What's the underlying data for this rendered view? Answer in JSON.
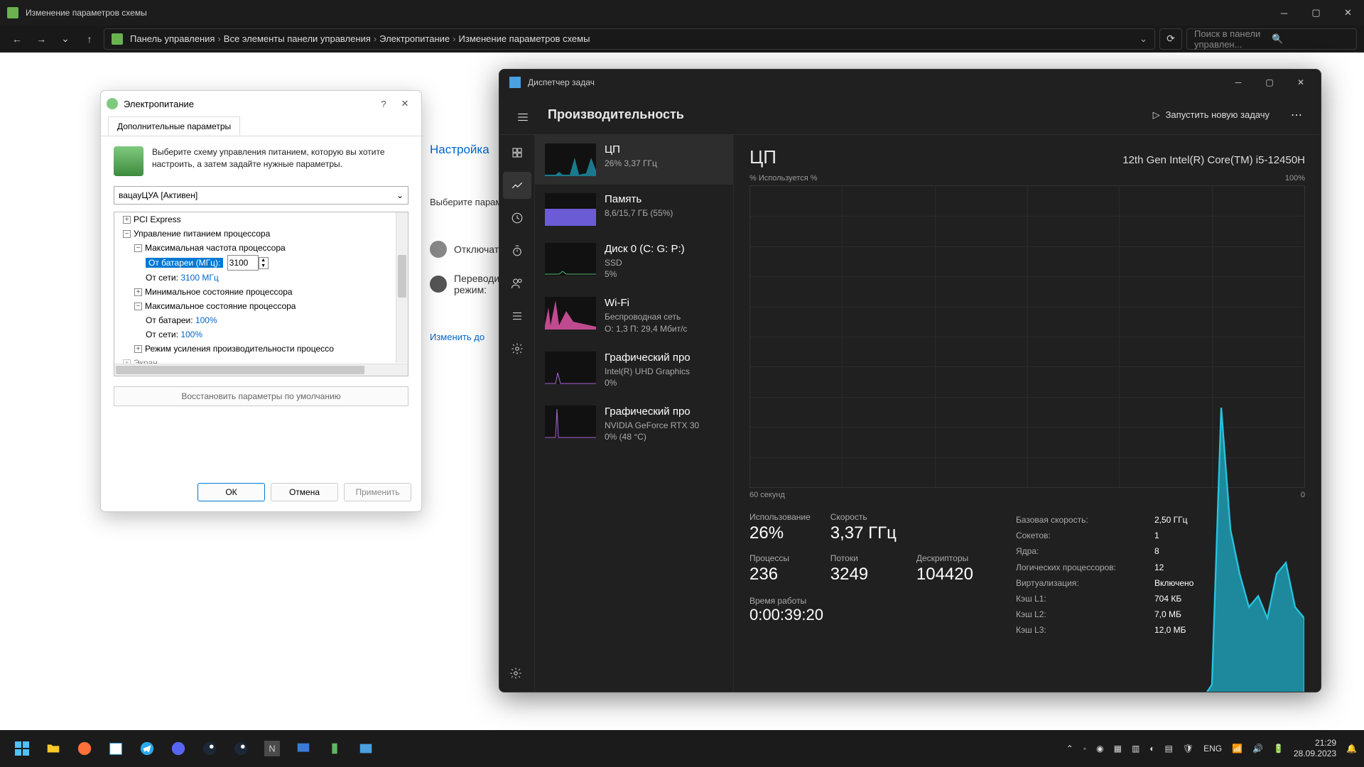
{
  "explorer": {
    "title": "Изменение параметров схемы",
    "breadcrumbs": [
      "Панель управления",
      "Все элементы панели управления",
      "Электропитание",
      "Изменение параметров схемы"
    ],
    "search_placeholder": "Поиск в панели управлен..."
  },
  "cp": {
    "heading": "Настройка",
    "subtitle": "Выберите парам",
    "row1": "Отключат",
    "row2a": "Переводи",
    "row2b": "режим:",
    "link": "Изменить до"
  },
  "po": {
    "title": "Электропитание",
    "tab": "Дополнительные параметры",
    "desc": "Выберите схему управления питанием, которую вы хотите настроить, а затем задайте нужные параметры.",
    "plan": "вацауЦУА [Активен]",
    "tree": {
      "pci": "PCI Express",
      "cpu_pm": "Управление питанием процессора",
      "max_freq": "Максимальная частота процессора",
      "batt_label": "От батареи (МГц):",
      "batt_value": "3100",
      "ac_label": "От сети:",
      "ac_value": "3100 МГц",
      "min_state": "Минимальное состояние процессора",
      "max_state": "Максимальное состояние процессора",
      "batt_pct_label": "От батареи:",
      "batt_pct": "100%",
      "ac_pct_label": "От сети:",
      "ac_pct": "100%",
      "boost": "Режим усиления производительности процессо",
      "screen": "Экран"
    },
    "restore": "Восстановить параметры по умолчанию",
    "ok": "ОК",
    "cancel": "Отмена",
    "apply": "Применить"
  },
  "tm": {
    "title": "Диспетчер задач",
    "page_title": "Производительность",
    "run_task": "Запустить новую задачу",
    "left": {
      "cpu": {
        "name": "ЦП",
        "sub": "26%  3,37 ГГц"
      },
      "mem": {
        "name": "Память",
        "sub": "8,6/15,7 ГБ (55%)"
      },
      "disk": {
        "name": "Диск 0 (C: G: P:)",
        "sub1": "SSD",
        "sub2": "5%"
      },
      "wifi": {
        "name": "Wi-Fi",
        "sub1": "Беспроводная сеть",
        "sub2": "О: 1,3  П: 29,4 Мбит/с"
      },
      "gpu0": {
        "name": "Графический про",
        "sub1": "Intel(R) UHD Graphics",
        "sub2": "0%"
      },
      "gpu1": {
        "name": "Графический про",
        "sub1": "NVIDIA GeForce RTX 30",
        "sub2": "0%  (48 °C)"
      }
    },
    "cpu": {
      "title": "ЦП",
      "subtitle": "% Используется %",
      "model": "12th Gen Intel(R) Core(TM) i5-12450H",
      "y_top": "100%",
      "x_left": "60 секунд",
      "x_right": "0",
      "stats": {
        "usage_l": "Использование",
        "usage_v": "26%",
        "speed_l": "Скорость",
        "speed_v": "3,37 ГГц",
        "proc_l": "Процессы",
        "proc_v": "236",
        "thr_l": "Потоки",
        "thr_v": "3249",
        "hnd_l": "Дескрипторы",
        "hnd_v": "104420"
      },
      "info": {
        "base_l": "Базовая скорость:",
        "base_v": "2,50 ГГц",
        "sock_l": "Сокетов:",
        "sock_v": "1",
        "cores_l": "Ядра:",
        "cores_v": "8",
        "lp_l": "Логических процессоров:",
        "lp_v": "12",
        "virt_l": "Виртуализация:",
        "virt_v": "Включено",
        "l1_l": "Кэш L1:",
        "l1_v": "704 КБ",
        "l2_l": "Кэш L2:",
        "l2_v": "7,0 МБ",
        "l3_l": "Кэш L3:",
        "l3_v": "12,0 МБ"
      },
      "uptime_l": "Время работы",
      "uptime_v": "0:00:39:20"
    }
  },
  "taskbar": {
    "lang": "ENG",
    "time": "21:29",
    "date": "28.09.2023"
  },
  "chart_data": {
    "type": "area",
    "title": "ЦП — % Используется",
    "ylabel": "%",
    "ylim": [
      0,
      100
    ],
    "xlabel": "секунд",
    "xlim": [
      60,
      0
    ],
    "x": [
      60,
      57,
      54,
      51,
      48,
      45,
      42,
      39,
      36,
      33,
      30,
      27,
      24,
      21,
      18,
      15,
      12,
      10,
      9,
      8,
      7,
      6,
      5,
      4,
      3,
      2,
      1,
      0
    ],
    "y": [
      3,
      3,
      3,
      3,
      3,
      3,
      3,
      3,
      3,
      3,
      3,
      3,
      3,
      3,
      3,
      4,
      5,
      10,
      60,
      38,
      30,
      24,
      26,
      22,
      30,
      32,
      24,
      22
    ]
  }
}
